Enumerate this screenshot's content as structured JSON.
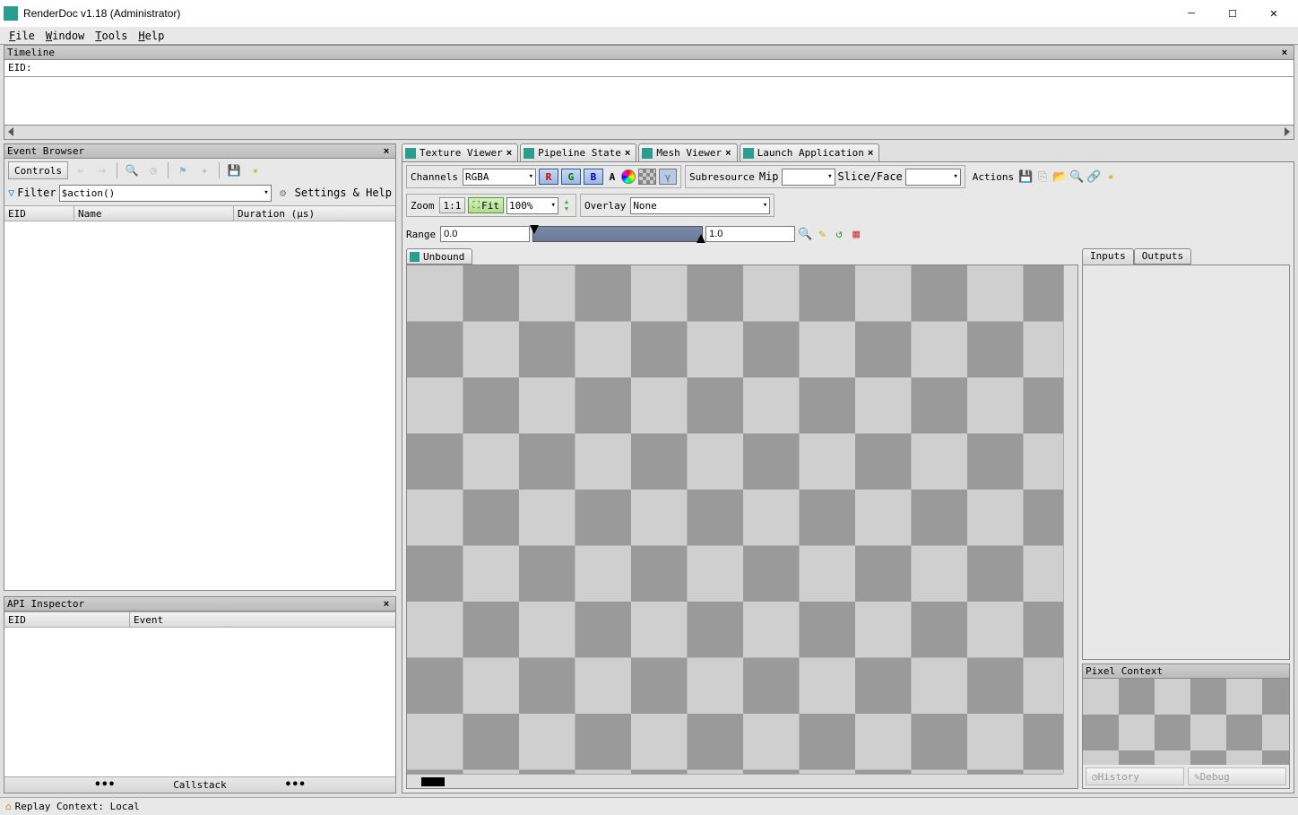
{
  "window": {
    "title": "RenderDoc v1.18 (Administrator)"
  },
  "menubar": {
    "file": "File",
    "window": "Window",
    "tools": "Tools",
    "help": "Help"
  },
  "timeline": {
    "title": "Timeline",
    "eid_label": "EID:"
  },
  "event_browser": {
    "title": "Event Browser",
    "controls_label": "Controls",
    "filter_label": "Filter",
    "filter_value": "$action()",
    "settings_help": "Settings & Help",
    "columns": {
      "eid": "EID",
      "name": "Name",
      "duration": "Duration (µs)"
    }
  },
  "api_inspector": {
    "title": "API Inspector",
    "columns": {
      "eid": "EID",
      "event": "Event"
    },
    "callstack": "Callstack"
  },
  "tabs": {
    "texture_viewer": "Texture Viewer",
    "pipeline_state": "Pipeline State",
    "mesh_viewer": "Mesh Viewer",
    "launch_application": "Launch Application"
  },
  "texture_viewer": {
    "channels_label": "Channels",
    "channels_value": "RGBA",
    "ch_r": "R",
    "ch_g": "G",
    "ch_b": "B",
    "ch_a": "A",
    "gamma_label": "γ",
    "subresource_label": "Subresource",
    "mip_label": "Mip",
    "sliceface_label": "Slice/Face",
    "actions_label": "Actions",
    "zoom_label": "Zoom",
    "one_to_one": "1:1",
    "fit_label": "Fit",
    "zoom_value": "100%",
    "overlay_label": "Overlay",
    "overlay_value": "None",
    "range_label": "Range",
    "range_min": "0.0",
    "range_max": "1.0",
    "unbound_tab": "Unbound",
    "inputs_tab": "Inputs",
    "outputs_tab": "Outputs",
    "pixel_context_title": "Pixel Context",
    "history_btn": "History",
    "debug_btn": "Debug"
  },
  "statusbar": {
    "replay_context": "Replay Context: Local"
  }
}
